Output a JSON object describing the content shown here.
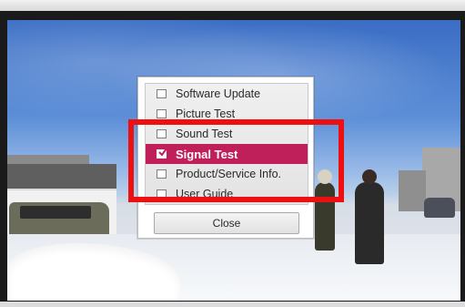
{
  "menu": {
    "items": [
      {
        "label": "Software Update",
        "checked": false,
        "selected": false
      },
      {
        "label": "Picture Test",
        "checked": false,
        "selected": false
      },
      {
        "label": "Sound Test",
        "checked": false,
        "selected": false
      },
      {
        "label": "Signal Test",
        "checked": true,
        "selected": true
      },
      {
        "label": "Product/Service Info.",
        "checked": false,
        "selected": false
      },
      {
        "label": "User Guide",
        "checked": false,
        "selected": false
      }
    ],
    "close_label": "Close"
  },
  "colors": {
    "selected_item_background": "#c0205a",
    "highlight_border": "#ee1010"
  },
  "icons": {
    "checkbox": "checkbox-icon",
    "check": "check-mark-icon"
  }
}
